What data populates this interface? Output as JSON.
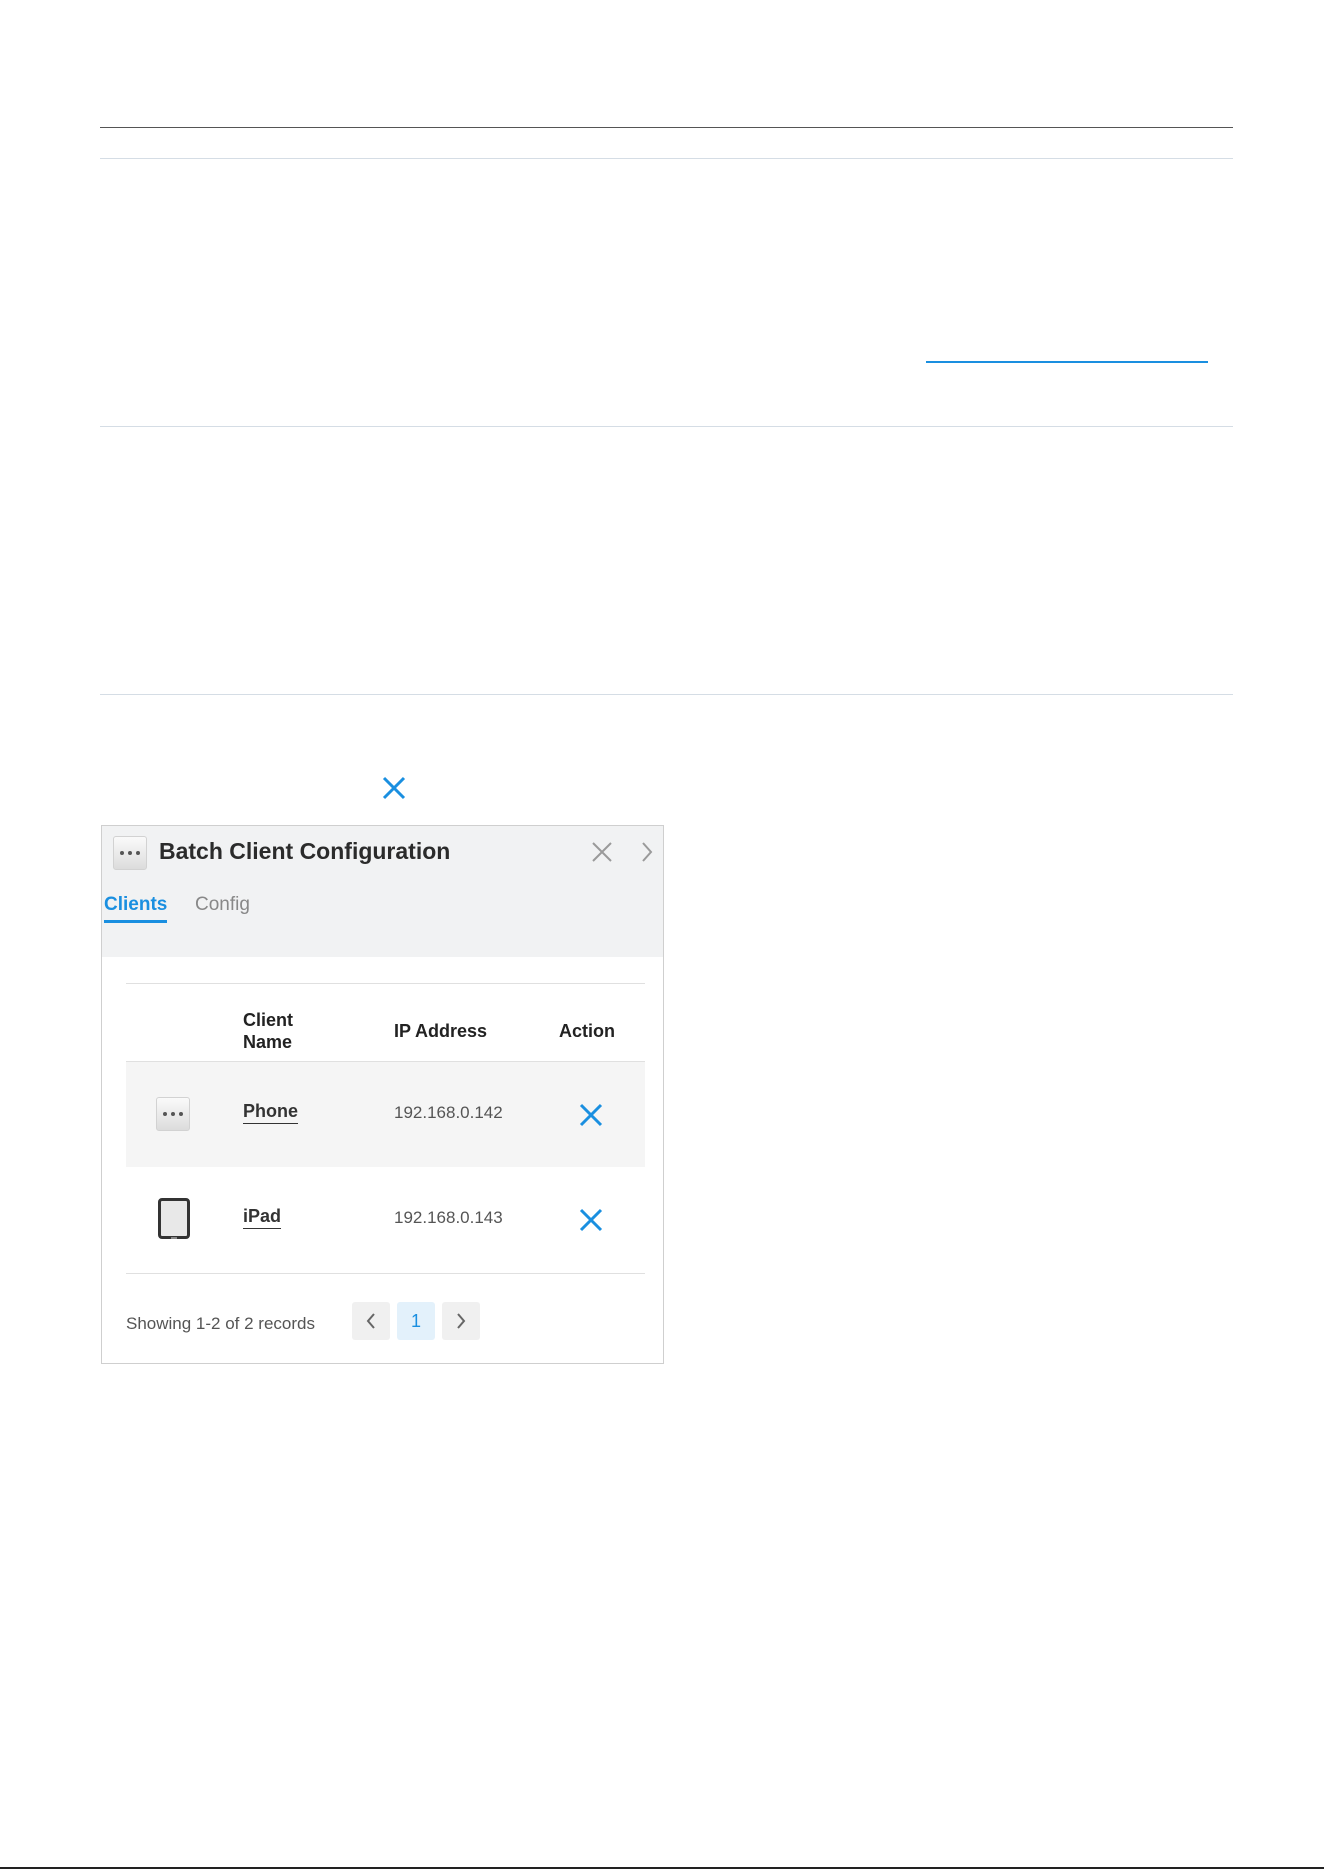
{
  "panel": {
    "title": "Batch Client Configuration",
    "tabs": [
      {
        "label": "Clients",
        "active": true
      },
      {
        "label": "Config",
        "active": false
      }
    ],
    "columns": [
      "Client",
      "Name",
      "IP Address",
      "Action"
    ],
    "rows": [
      {
        "name": "Phone",
        "ip": "192.168.0.142",
        "icon": "more-dots-icon",
        "shaded": true
      },
      {
        "name": "iPad",
        "ip": "192.168.0.143",
        "icon": "tablet-icon",
        "shaded": false
      }
    ],
    "footer": "Showing 1-2 of 2 records",
    "pagination": {
      "current": "1"
    }
  },
  "colors": {
    "accent": "#1a8fe0",
    "header_bg": "#f1f2f3",
    "row_shade": "#f5f5f5"
  }
}
